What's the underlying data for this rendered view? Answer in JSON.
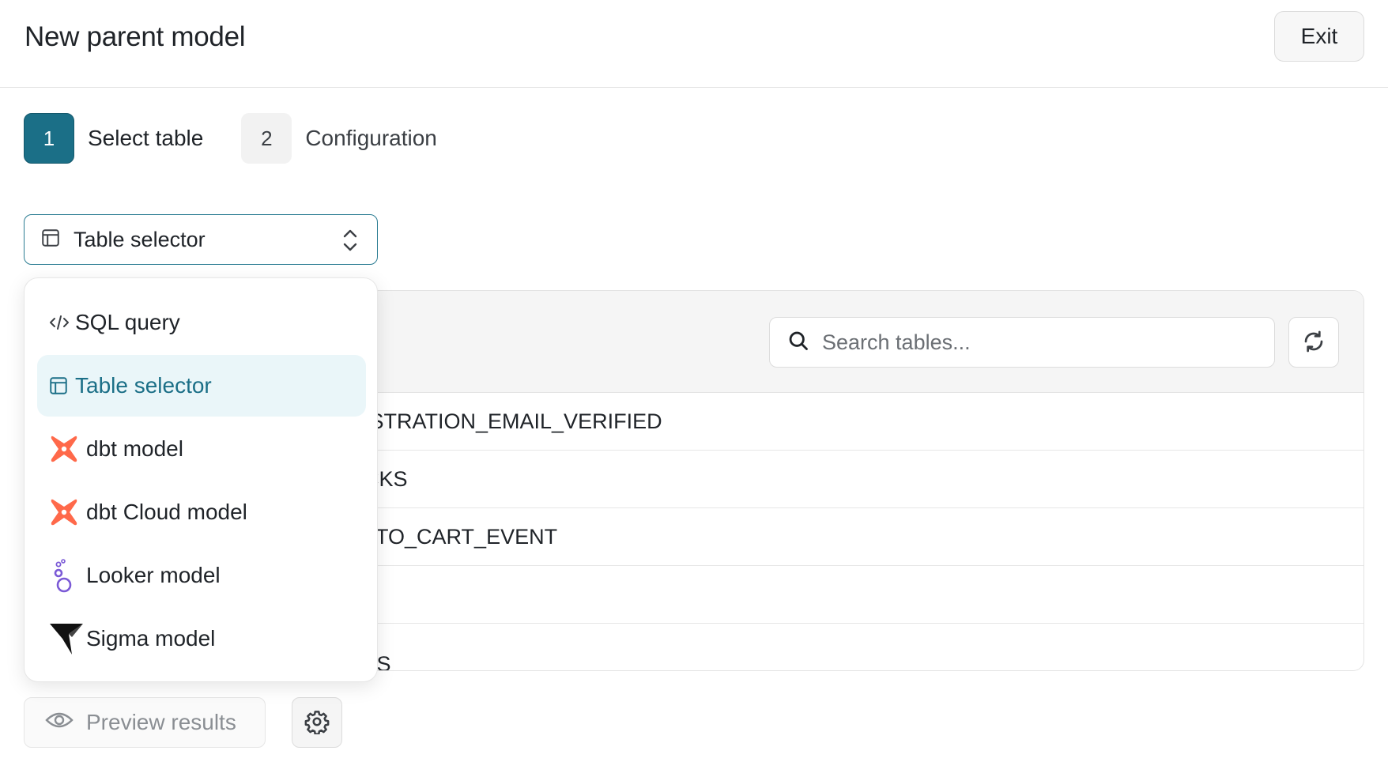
{
  "header": {
    "title": "New parent model",
    "exit_label": "Exit"
  },
  "steps": [
    {
      "number": "1",
      "label": "Select table",
      "active": true
    },
    {
      "number": "2",
      "label": "Configuration",
      "active": false
    }
  ],
  "source_selector": {
    "value": "Table selector"
  },
  "dropdown": {
    "items": [
      {
        "label": "SQL query",
        "icon": "code-icon"
      },
      {
        "label": "Table selector",
        "icon": "table-icon",
        "selected": true
      },
      {
        "label": "dbt model",
        "icon": "dbt-logo-icon"
      },
      {
        "label": "dbt Cloud model",
        "icon": "dbt-logo-icon"
      },
      {
        "label": "Looker model",
        "icon": "looker-logo-icon"
      },
      {
        "label": "Sigma model",
        "icon": "sigma-logo-icon"
      }
    ]
  },
  "table_panel": {
    "search_placeholder": "Search tables...",
    "rows": [
      "ISTRATION_EMAIL_VERIFIED",
      "CKS",
      "_TO_CART_EVENT",
      "",
      "TS"
    ]
  },
  "footer": {
    "preview_label": "Preview results"
  },
  "colors": {
    "accent": "#1b6f87",
    "selected_bg": "#eaf6f9",
    "dbt": "#ff694a",
    "looker": "#7b5ad6"
  }
}
